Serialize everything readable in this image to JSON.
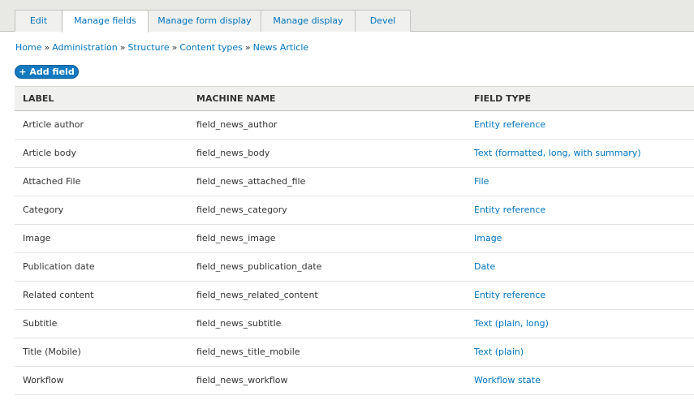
{
  "tabs": [
    {
      "label": "Edit"
    },
    {
      "label": "Manage fields"
    },
    {
      "label": "Manage form display"
    },
    {
      "label": "Manage display"
    },
    {
      "label": "Devel"
    }
  ],
  "breadcrumb": [
    "Home",
    "Administration",
    "Structure",
    "Content types",
    "News Article"
  ],
  "breadcrumb_separator": "»",
  "add_field_label": "+ Add field",
  "table": {
    "headers": {
      "label": "LABEL",
      "machine": "MACHINE NAME",
      "type": "FIELD TYPE"
    },
    "rows": [
      {
        "label": "Article author",
        "machine": "field_news_author",
        "type": "Entity reference"
      },
      {
        "label": "Article body",
        "machine": "field_news_body",
        "type": "Text (formatted, long, with summary)"
      },
      {
        "label": "Attached File",
        "machine": "field_news_attached_file",
        "type": "File"
      },
      {
        "label": "Category",
        "machine": "field_news_category",
        "type": "Entity reference"
      },
      {
        "label": "Image",
        "machine": "field_news_image",
        "type": "Image"
      },
      {
        "label": "Publication date",
        "machine": "field_news_publication_date",
        "type": "Date"
      },
      {
        "label": "Related content",
        "machine": "field_news_related_content",
        "type": "Entity reference"
      },
      {
        "label": "Subtitle",
        "machine": "field_news_subtitle",
        "type": "Text (plain, long)"
      },
      {
        "label": "Title (Mobile)",
        "machine": "field_news_title_mobile",
        "type": "Text (plain)"
      },
      {
        "label": "Workflow",
        "machine": "field_news_workflow",
        "type": "Workflow state"
      }
    ]
  },
  "colors": {
    "link": "#0074bd",
    "button": "#1379c0",
    "tabbar": "#e8e8e5",
    "header_bg": "#f0f0ee"
  }
}
